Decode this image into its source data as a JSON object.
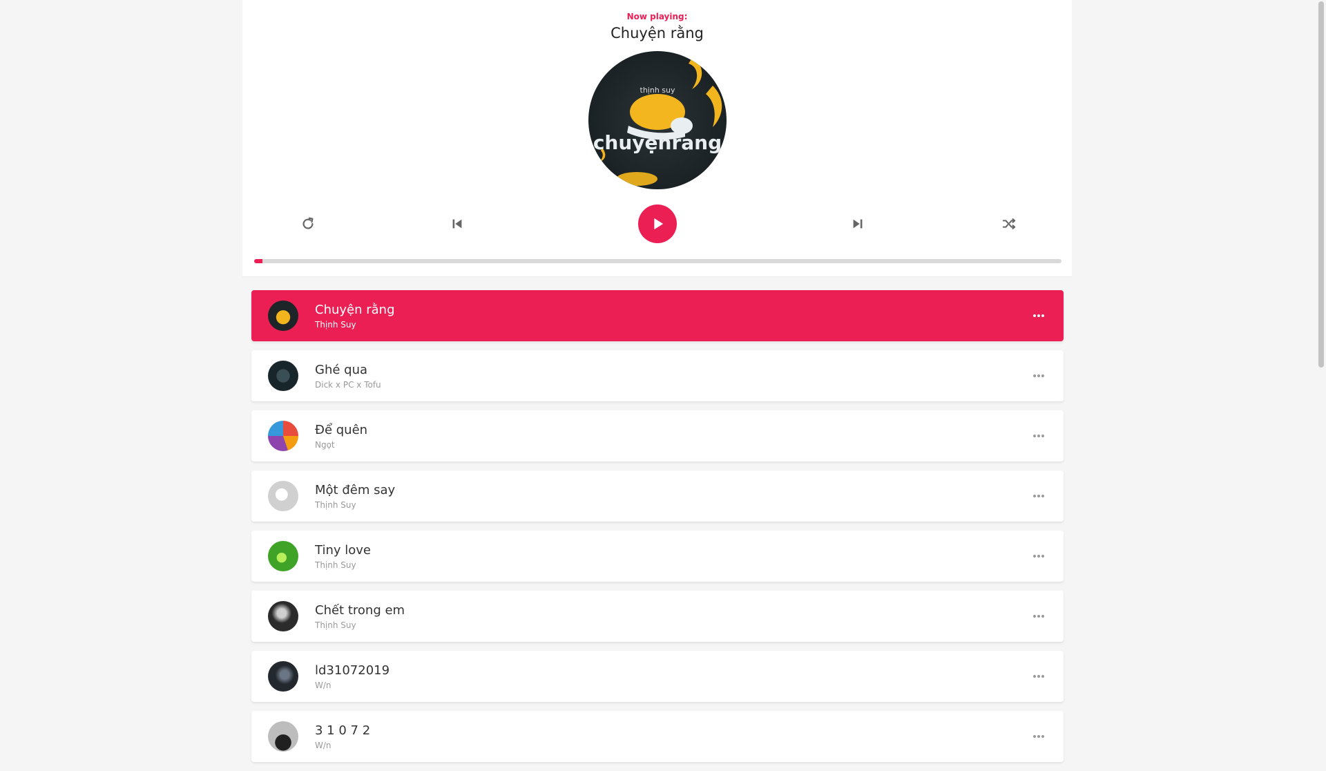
{
  "player": {
    "now_playing_label": "Now playing:",
    "current_title": "Chuyện rằng",
    "disc_art_text": "chuyệnrang",
    "disc_art_artist": "thịnh suy",
    "progress_percent": 1
  },
  "icons": {
    "repeat": "repeat-icon",
    "prev": "skip-back-icon",
    "play": "play-icon",
    "next": "skip-forward-icon",
    "shuffle": "shuffle-icon",
    "more": "more-horizontal-icon"
  },
  "colors": {
    "accent": "#ec1f55",
    "background": "#f5f5f5",
    "card": "#ffffff"
  },
  "playlist": [
    {
      "title": "Chuyện rằng",
      "artist": "Thịnh Suy",
      "active": true
    },
    {
      "title": "Ghé qua",
      "artist": "Dick x PC x Tofu",
      "active": false
    },
    {
      "title": "Để quên",
      "artist": "Ngọt",
      "active": false
    },
    {
      "title": "Một đêm say",
      "artist": "Thịnh Suy",
      "active": false
    },
    {
      "title": "Tiny love",
      "artist": "Thịnh Suy",
      "active": false
    },
    {
      "title": "Chết trong em",
      "artist": "Thịnh Suy",
      "active": false
    },
    {
      "title": "ld31072019",
      "artist": "W/n",
      "active": false
    },
    {
      "title": "3 1 0 7 2",
      "artist": "W/n",
      "active": false
    }
  ]
}
